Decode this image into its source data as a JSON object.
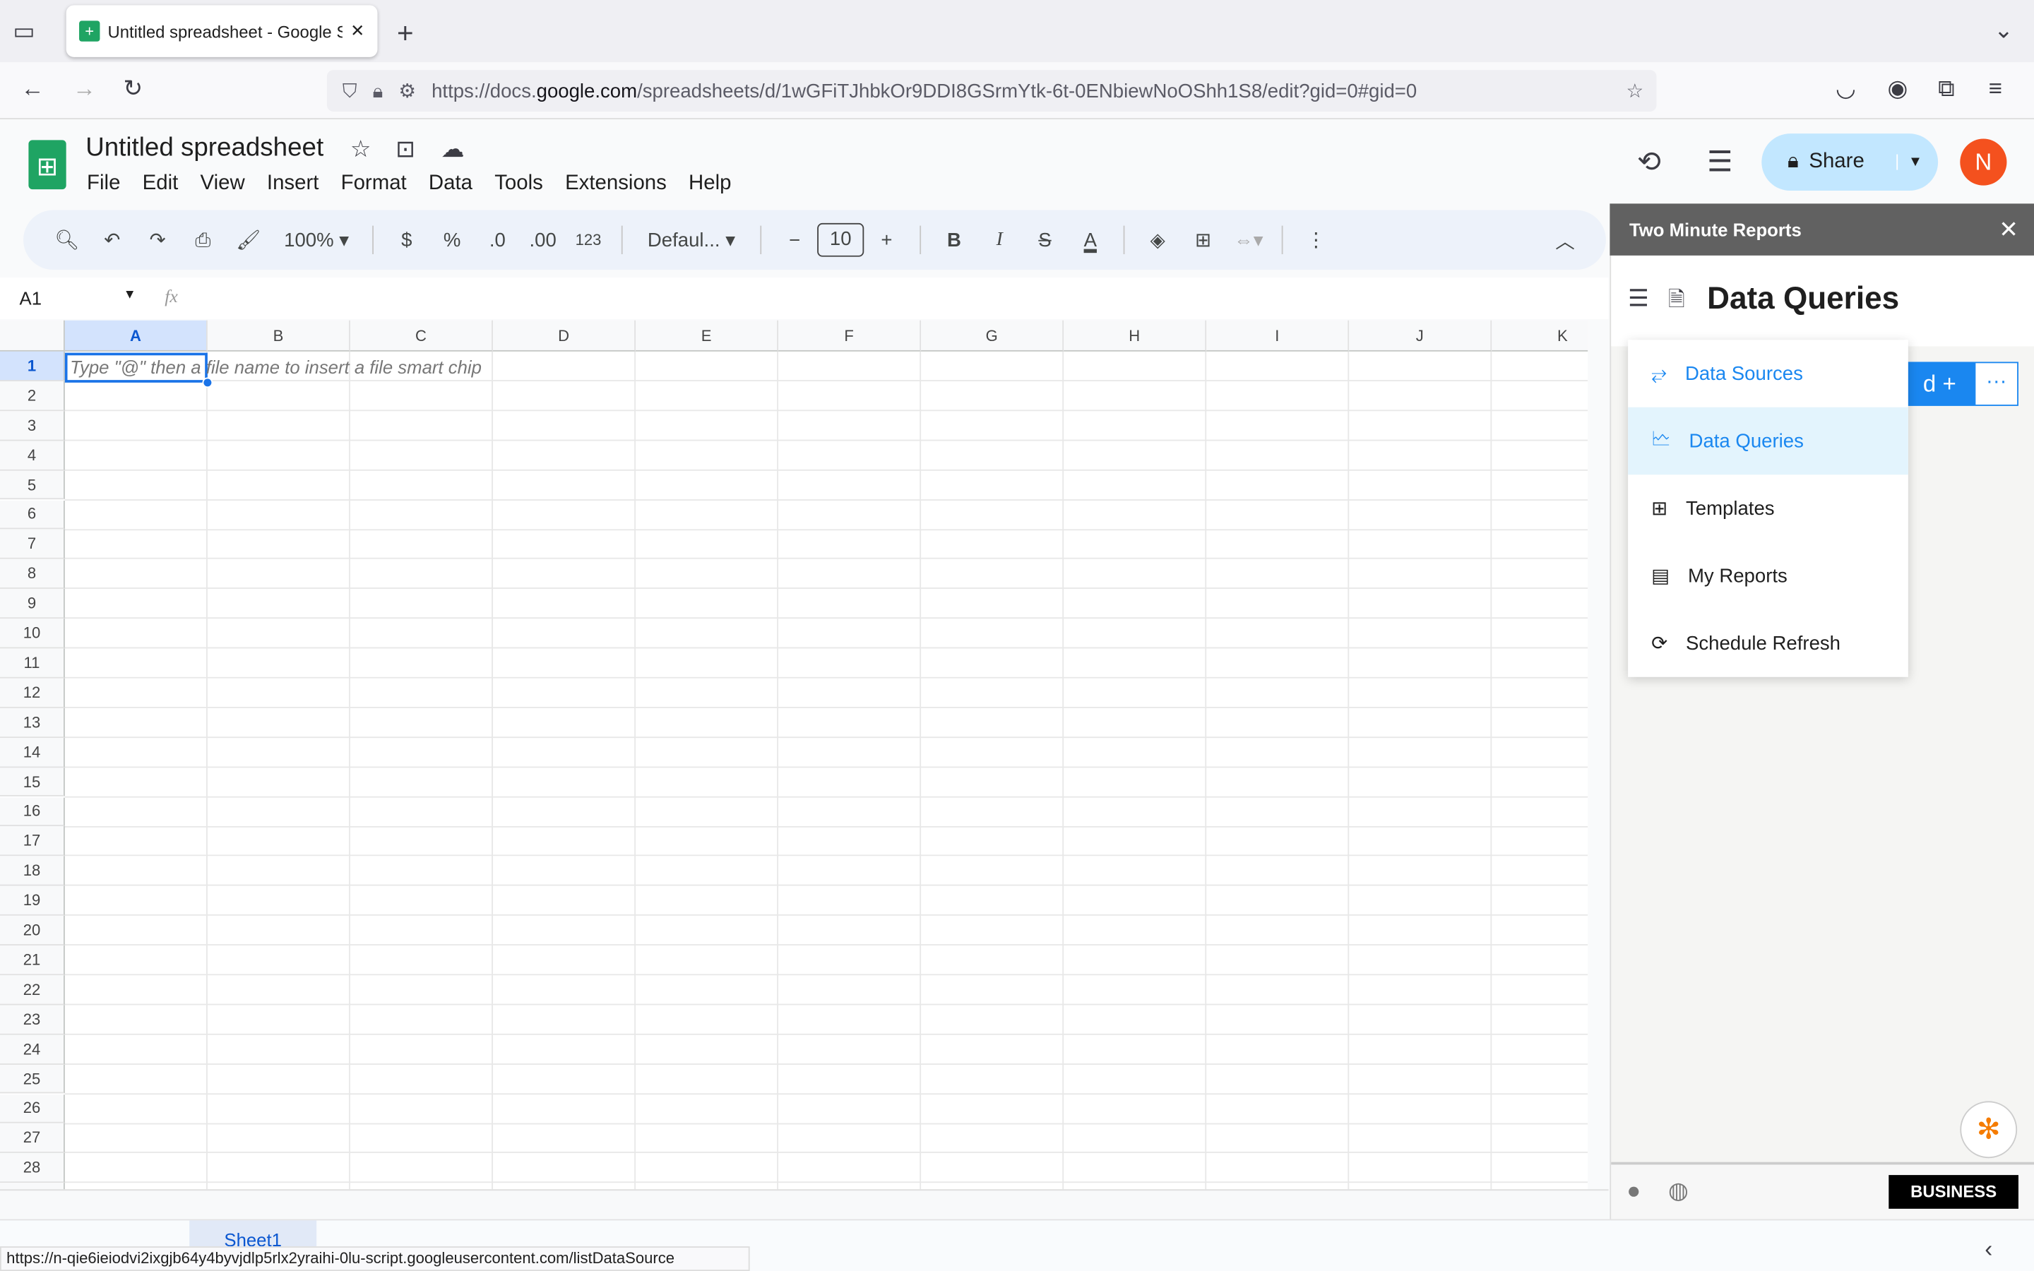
{
  "browser": {
    "tab_title": "Untitled spreadsheet - Google S",
    "url_prefix": "https://docs.",
    "url_domain": "google.com",
    "url_rest": "/spreadsheets/d/1wGFiTJhbkOr9DDI8GSrmYtk-6t-0ENbiewNoOShh1S8/edit?gid=0#gid=0",
    "status_url": "https://n-qie6ieiodvi2ixgjb64y4byvjdlp5rlx2yraihi-0lu-script.googleusercontent.com/listDataSource"
  },
  "doc": {
    "title": "Untitled spreadsheet",
    "menu": [
      "File",
      "Edit",
      "View",
      "Insert",
      "Format",
      "Data",
      "Tools",
      "Extensions",
      "Help"
    ],
    "share": "Share",
    "avatar": "N"
  },
  "toolbar": {
    "zoom": "100%",
    "currency": "$",
    "percent": "%",
    "dec_less": ".0",
    "dec_more": ".00",
    "number_format": "123",
    "font": "Defaul...",
    "font_size": "10",
    "bold": "B",
    "italic": "I",
    "strike": "S",
    "text_color": "A"
  },
  "formula": {
    "cell_ref": "A1",
    "fx": "fx"
  },
  "grid": {
    "columns": [
      "A",
      "B",
      "C",
      "D",
      "E",
      "F",
      "G",
      "H",
      "I",
      "J",
      "K"
    ],
    "rows": 28,
    "a1_hint": "Type \"@\" then a file name to insert a file smart chip"
  },
  "sheets": {
    "active": "Sheet1"
  },
  "sidebar": {
    "title": "Two Minute Reports",
    "page_title": "Data Queries",
    "add_label": "d +",
    "more": "···",
    "badge": "BUSINESS",
    "accent": "#1a87f0",
    "menu": [
      {
        "label": "Data Sources",
        "icon": "plug-icon"
      },
      {
        "label": "Data Queries",
        "icon": "chart-file-icon"
      },
      {
        "label": "Templates",
        "icon": "grid-icon"
      },
      {
        "label": "My Reports",
        "icon": "table-file-icon"
      },
      {
        "label": "Schedule Refresh",
        "icon": "clock-refresh-icon"
      }
    ]
  }
}
